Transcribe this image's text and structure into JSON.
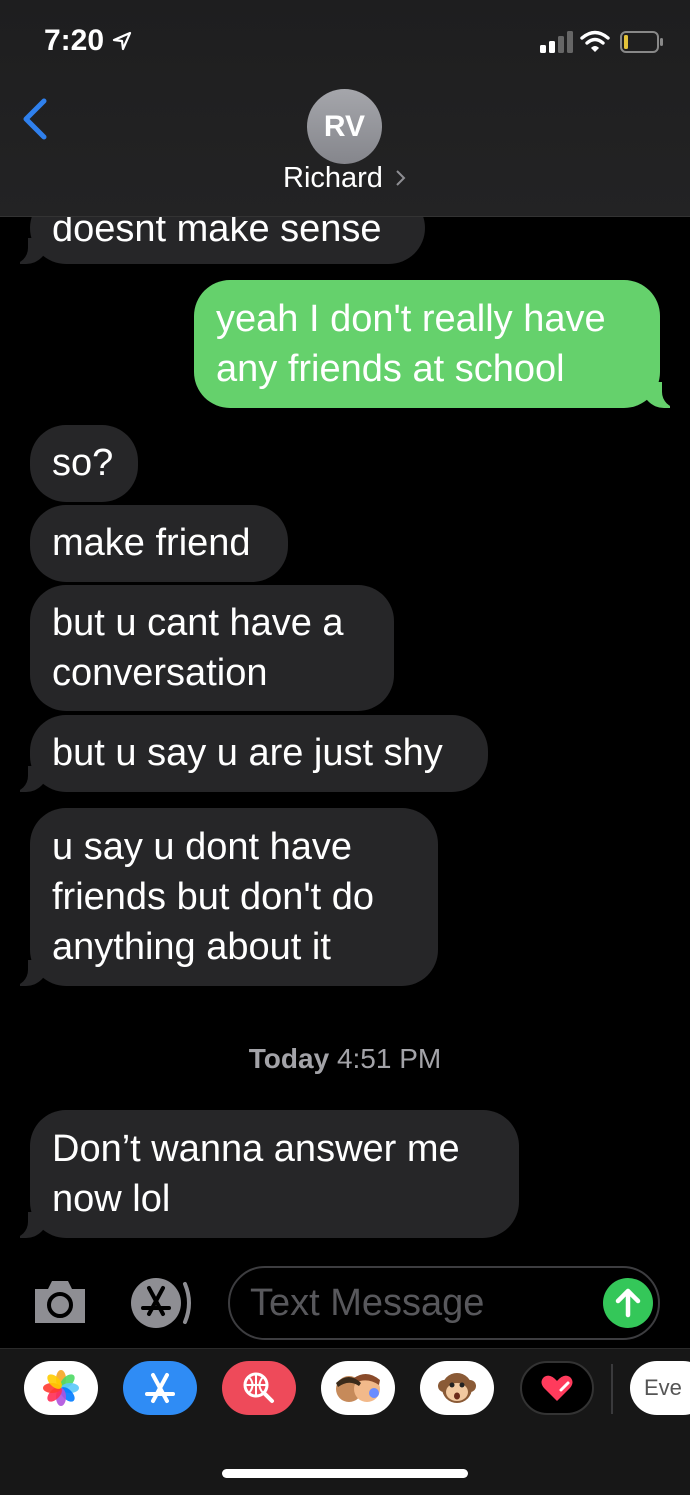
{
  "status_bar": {
    "time": "7:20"
  },
  "header": {
    "avatar_initials": "RV",
    "contact_name": "Richard"
  },
  "messages": [
    {
      "text": "doesnt make sense"
    },
    {
      "line1": "yeah I don't really have",
      "line2": "any friends at school"
    },
    {
      "text": "so?"
    },
    {
      "text": "make friend"
    },
    {
      "line1": "but u cant have a",
      "line2": "conversation"
    },
    {
      "text": "but u say u are just shy"
    },
    {
      "line1": "u say u dont have",
      "line2": "friends but don't do",
      "line3": "anything about it"
    },
    {
      "line1": "Don’t wanna answer me",
      "line2": "now lol"
    }
  ],
  "timestamp": {
    "day": "Today",
    "time": "4:51 PM"
  },
  "input": {
    "placeholder": "Text Message"
  },
  "app_drawer": {
    "last_app_label": "Eve"
  },
  "colors": {
    "sent_bubble": "#65d16c",
    "received_bubble": "#262628",
    "accent": "#2f80ed"
  }
}
